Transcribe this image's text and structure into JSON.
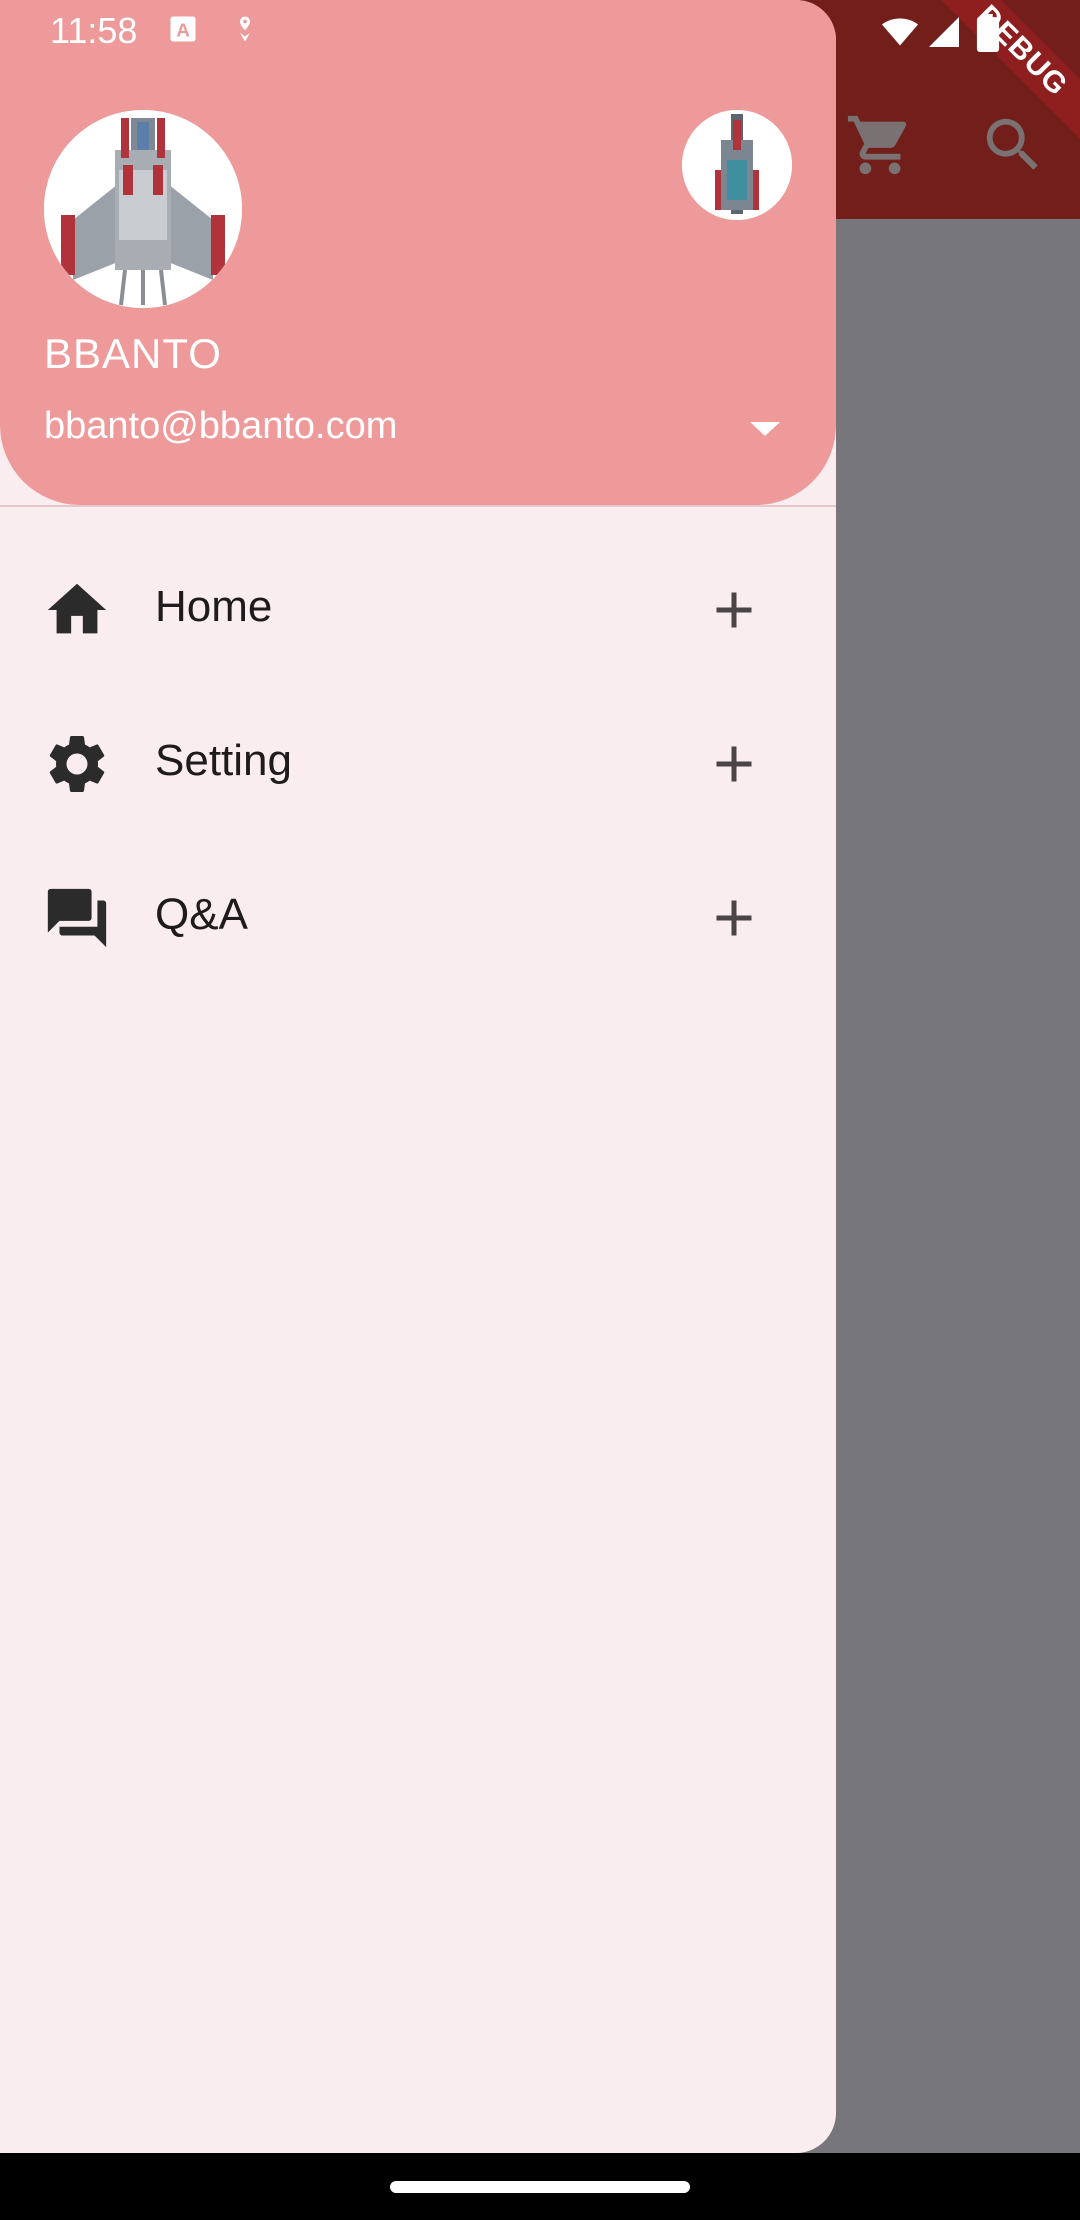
{
  "status_bar": {
    "time": "11:58"
  },
  "debug_banner": {
    "label": "DEBUG"
  },
  "app_bar": {
    "icons": [
      "shopping-cart-icon",
      "search-icon"
    ]
  },
  "drawer": {
    "account": {
      "name": "BBANTO",
      "email": "bbanto@bbanto.com"
    },
    "items": [
      {
        "label": "Home",
        "icon": "home-icon"
      },
      {
        "label": "Setting",
        "icon": "gear-icon"
      },
      {
        "label": "Q&A",
        "icon": "forum-icon"
      }
    ]
  },
  "colors": {
    "header": "#ee9a9a",
    "drawer_bg": "#faedf0",
    "app_bar": "#721e1a",
    "scrim": "#77767a",
    "debug": "#8f1e1e"
  }
}
